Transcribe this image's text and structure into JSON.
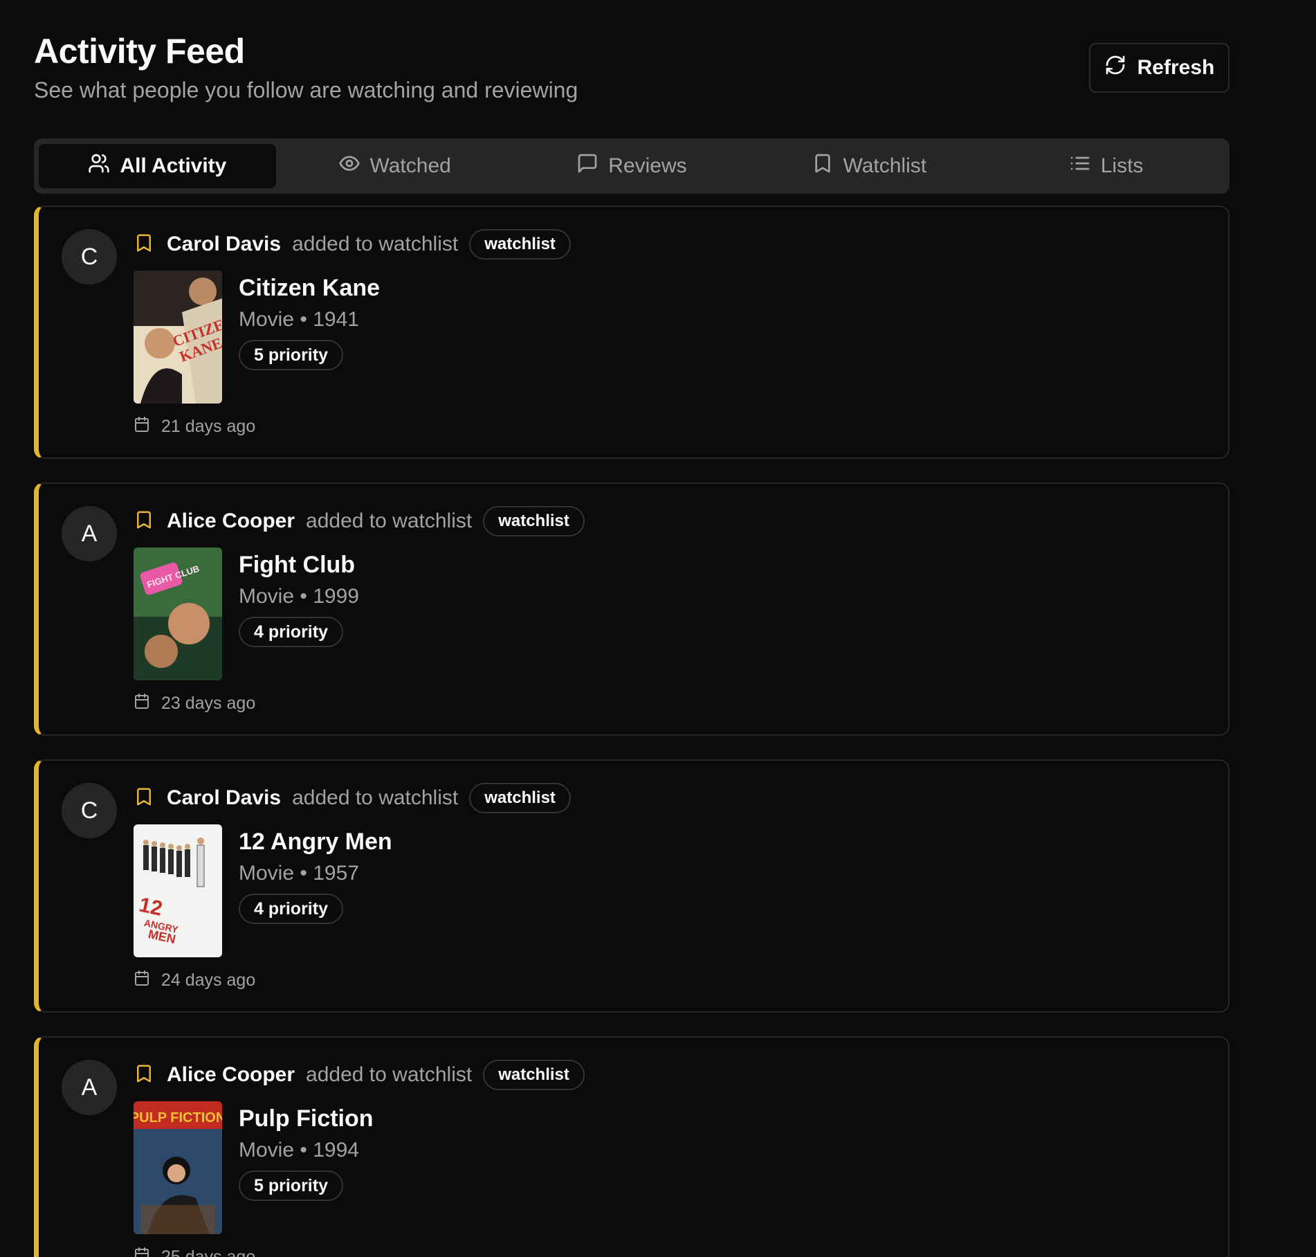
{
  "header": {
    "title": "Activity Feed",
    "subtitle": "See what people you follow are watching and reviewing",
    "refresh_label": "Refresh"
  },
  "tabs": [
    {
      "label": "All Activity",
      "icon": "users-icon",
      "active": true
    },
    {
      "label": "Watched",
      "icon": "eye-icon",
      "active": false
    },
    {
      "label": "Reviews",
      "icon": "message-icon",
      "active": false
    },
    {
      "label": "Watchlist",
      "icon": "bookmark-icon",
      "active": false
    },
    {
      "label": "Lists",
      "icon": "list-icon",
      "active": false
    }
  ],
  "colors": {
    "accent": "#e5b52d",
    "background": "#0b0b0b",
    "muted_text": "#a3a3a3",
    "border": "#262626"
  },
  "feed": [
    {
      "avatar_initial": "C",
      "user": "Carol Davis",
      "action": "added to watchlist",
      "badge": "watchlist",
      "title": "Citizen Kane",
      "meta": "Movie • 1941",
      "priority": "5 priority",
      "time": "21 days ago",
      "poster_icon": "citizen-kane-poster"
    },
    {
      "avatar_initial": "A",
      "user": "Alice Cooper",
      "action": "added to watchlist",
      "badge": "watchlist",
      "title": "Fight Club",
      "meta": "Movie • 1999",
      "priority": "4 priority",
      "time": "23 days ago",
      "poster_icon": "fight-club-poster"
    },
    {
      "avatar_initial": "C",
      "user": "Carol Davis",
      "action": "added to watchlist",
      "badge": "watchlist",
      "title": "12 Angry Men",
      "meta": "Movie • 1957",
      "priority": "4 priority",
      "time": "24 days ago",
      "poster_icon": "12-angry-men-poster"
    },
    {
      "avatar_initial": "A",
      "user": "Alice Cooper",
      "action": "added to watchlist",
      "badge": "watchlist",
      "title": "Pulp Fiction",
      "meta": "Movie • 1994",
      "priority": "5 priority",
      "time": "25 days ago",
      "poster_icon": "pulp-fiction-poster"
    }
  ]
}
